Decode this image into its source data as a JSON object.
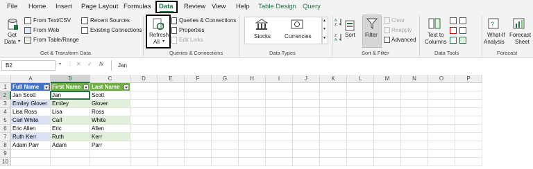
{
  "menu": {
    "file": "File",
    "home": "Home",
    "insert": "Insert",
    "page_layout": "Page Layout",
    "formulas": "Formulas",
    "data": "Data",
    "review": "Review",
    "view": "View",
    "help": "Help",
    "table_design": "Table Design",
    "query": "Query"
  },
  "ribbon": {
    "get_data": "Get",
    "get_data2": "Data",
    "from_text_csv": "From Text/CSV",
    "from_web": "From Web",
    "from_table_range": "From Table/Range",
    "recent_sources": "Recent Sources",
    "existing_connections": "Existing Connections",
    "group_get_transform": "Get & Transform Data",
    "refresh": "Refresh",
    "refresh_all": "All",
    "queries_connections": "Queries & Connections",
    "properties": "Properties",
    "edit_links": "Edit Links",
    "group_queries": "Queries & Connections",
    "stocks": "Stocks",
    "currencies": "Currencies",
    "group_data_types": "Data Types",
    "sort": "Sort",
    "filter": "Filter",
    "clear": "Clear",
    "reapply": "Reapply",
    "advanced": "Advanced",
    "group_sort_filter": "Sort & Filter",
    "text_to": "Text to",
    "columns": "Columns",
    "group_data_tools": "Data Tools",
    "what_if": "What-If",
    "analysis": "Analysis",
    "forecast": "Forecast",
    "sheet": "Sheet",
    "group_forecast": "Forecast"
  },
  "formula_bar": {
    "name_box": "B2",
    "fx": "fx",
    "content": "Jan"
  },
  "columns": [
    "A",
    "B",
    "C",
    "D",
    "E",
    "F",
    "G",
    "H",
    "I",
    "J",
    "K",
    "L",
    "M",
    "N",
    "O",
    "P"
  ],
  "rows": [
    "1",
    "2",
    "3",
    "4",
    "5",
    "6",
    "7",
    "8",
    "9",
    "10"
  ],
  "table": {
    "headers": [
      "Full Name",
      "First Name",
      "Last Name"
    ],
    "rows": [
      [
        "Jan Scott",
        "Jan",
        "Scott"
      ],
      [
        "Emiley Glover",
        "Emiley",
        "Glover"
      ],
      [
        "Lisa Ross",
        "Lisa",
        "Ross"
      ],
      [
        "Carl White",
        "Carl",
        "White"
      ],
      [
        "Eric Allen",
        "Eric",
        "Allen"
      ],
      [
        "Ruth Kerr",
        "Ruth",
        "Kerr"
      ],
      [
        "Adam Parr",
        "Adam",
        "Parr"
      ]
    ]
  },
  "colors": {
    "accent": "#217346",
    "table_a_header": "#4472c4",
    "table_bc_header": "#70ad47",
    "table_a_band": "#d9e1f2",
    "table_bc_band": "#e2efda"
  }
}
